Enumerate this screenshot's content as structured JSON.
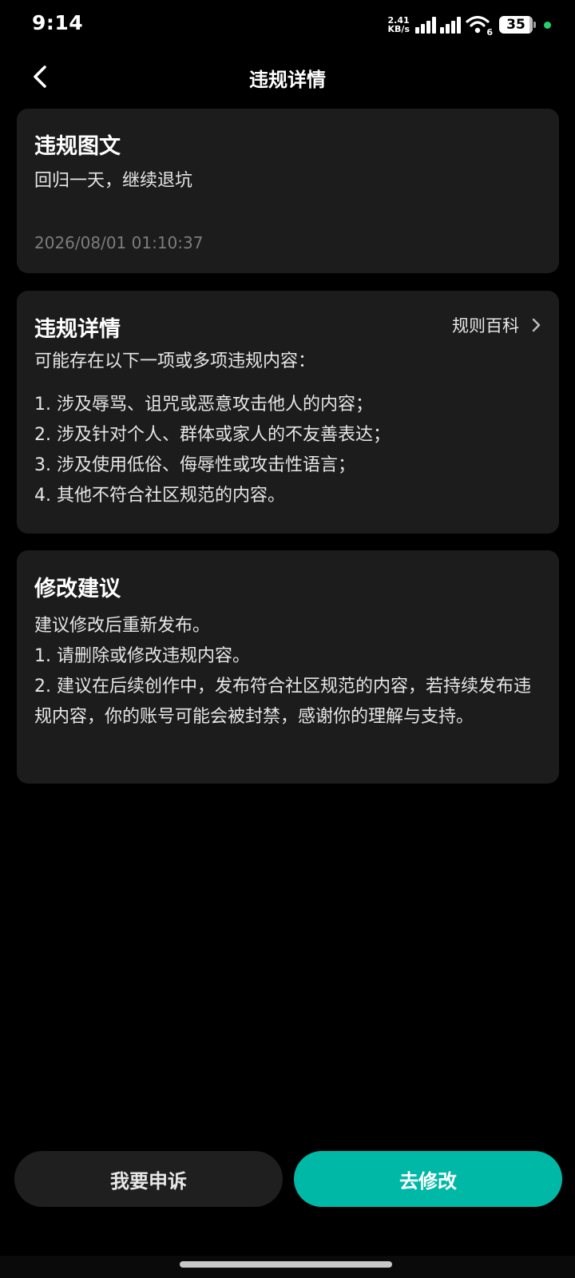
{
  "status_bar": {
    "time": "9:14",
    "net_speed_value": "2.41",
    "net_speed_unit": "KB/s",
    "wifi_badge": "6",
    "battery_level": "35"
  },
  "header": {
    "title": "违规详情"
  },
  "post_card": {
    "title": "违规图文",
    "content": "回归一天，继续退坑",
    "timestamp": "2026/08/01 01:10:37"
  },
  "details_card": {
    "title": "违规详情",
    "rules_link": "规则百科",
    "intro": "可能存在以下一项或多项违规内容：",
    "items": [
      "1. 涉及辱骂、诅咒或恶意攻击他人的内容；",
      "2. 涉及针对个人、群体或家人的不友善表达；",
      "3. 涉及使用低俗、侮辱性或攻击性语言；",
      "4. 其他不符合社区规范的内容。"
    ]
  },
  "suggestion_card": {
    "title": "修改建议",
    "lines": [
      "建议修改后重新发布。",
      "1. 请删除或修改违规内容。",
      "2. 建议在后续创作中，发布符合社区规范的内容，若持续发布违规内容，你的账号可能会被封禁，感谢你的理解与支持。"
    ]
  },
  "actions": {
    "appeal_label": "我要申诉",
    "modify_label": "去修改"
  },
  "colors": {
    "background": "#000000",
    "card": "#1c1c1c",
    "accent": "#00b8a6",
    "secondary_button": "#1f1f1f",
    "muted_text": "#7d7d7d",
    "battery_dot": "#22d16b"
  },
  "icons": {
    "back": "chevron-left-icon",
    "rules_arrow": "chevron-right-icon",
    "signal": "signal-icon",
    "wifi": "wifi-icon",
    "battery": "battery-icon"
  }
}
